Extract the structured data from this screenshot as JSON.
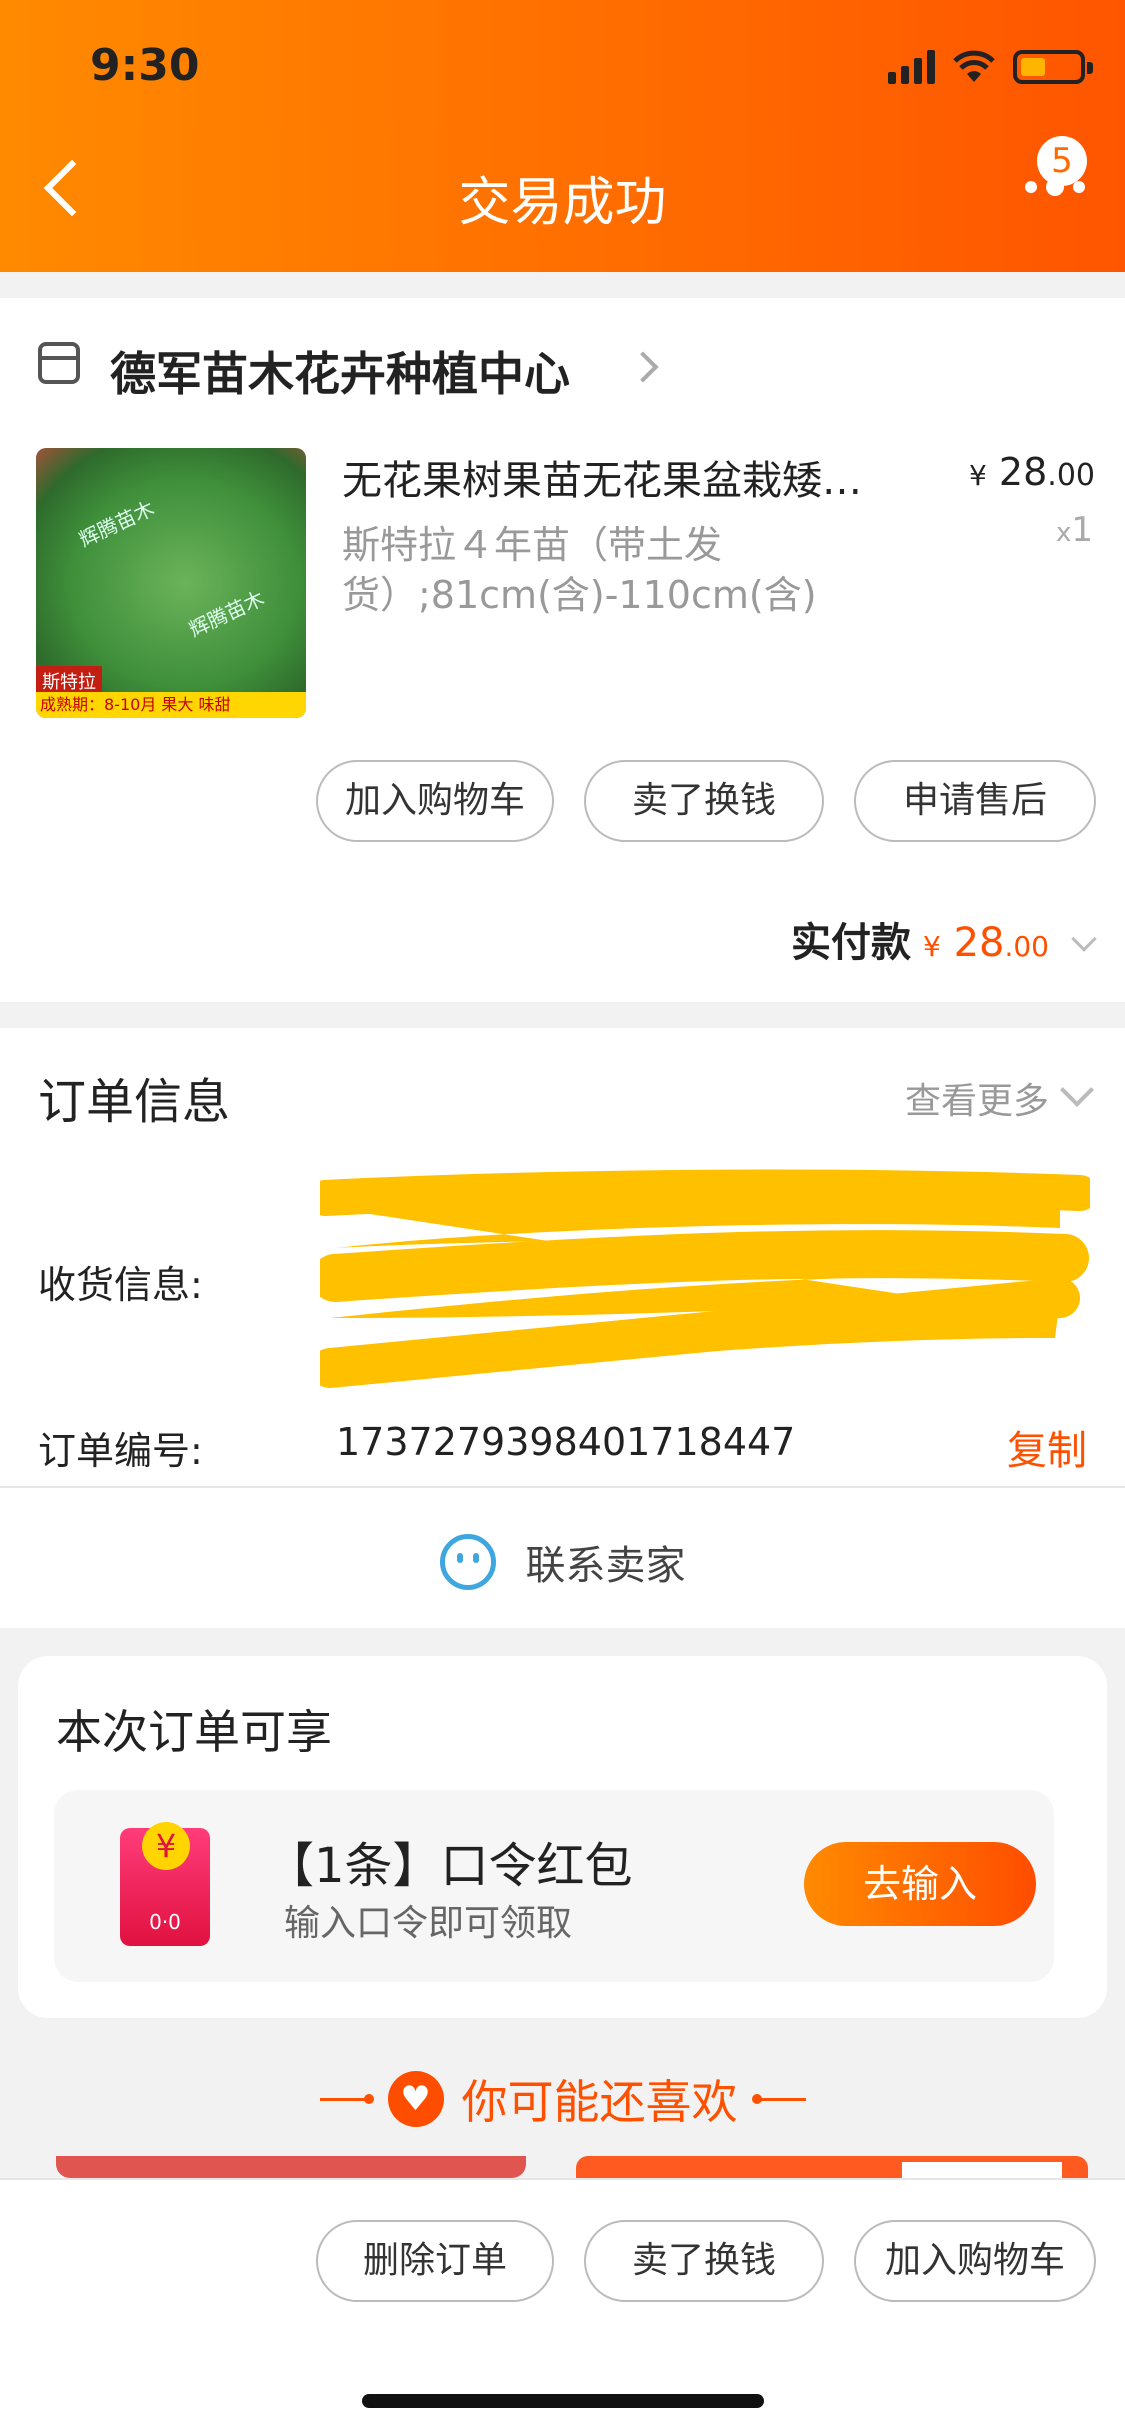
{
  "status": {
    "time": "9:30"
  },
  "header": {
    "title": "交易成功",
    "badge_count": "5"
  },
  "shop": {
    "name": "德军苗木花卉种植中心"
  },
  "product": {
    "title": "无花果树果苗无花果盆栽矮…",
    "spec": "斯特拉４年苗（带土发货）;81cm(含)-110cm(含)",
    "price_currency": "¥",
    "price_int": "28",
    "price_dec": ".00",
    "qty_prefix": "x",
    "qty": "1",
    "image": {
      "watermark": "辉腾苗木",
      "tag": "斯特拉",
      "strip": "成熟期：8-10月  果大  味甜"
    }
  },
  "actions": {
    "add_cart": "加入购物车",
    "sell": "卖了换钱",
    "after_sale": "申请售后"
  },
  "payment": {
    "label": "实付款",
    "currency": "¥",
    "amount_int": "28",
    "amount_dec": ".00"
  },
  "order": {
    "title": "订单信息",
    "see_more": "查看更多",
    "shipping_label": "收货信息:",
    "order_no_label": "订单编号:",
    "order_no": "1737279398401718447",
    "copy": "复制",
    "contact": "联系卖家"
  },
  "benefit": {
    "title": "本次订单可享",
    "coupon_title": "【1条】口令红包",
    "coupon_sub": "输入口令即可领取",
    "coupon_button": "去输入"
  },
  "recommend": {
    "title": "你可能还喜欢"
  },
  "bottom": {
    "delete": "删除订单",
    "sell": "卖了换钱",
    "add_cart": "加入购物车"
  },
  "colors": {
    "accent": "#ff5000",
    "header_start": "#ff8a00",
    "header_end": "#ff5500",
    "contact_blue": "#3fa7e0"
  }
}
